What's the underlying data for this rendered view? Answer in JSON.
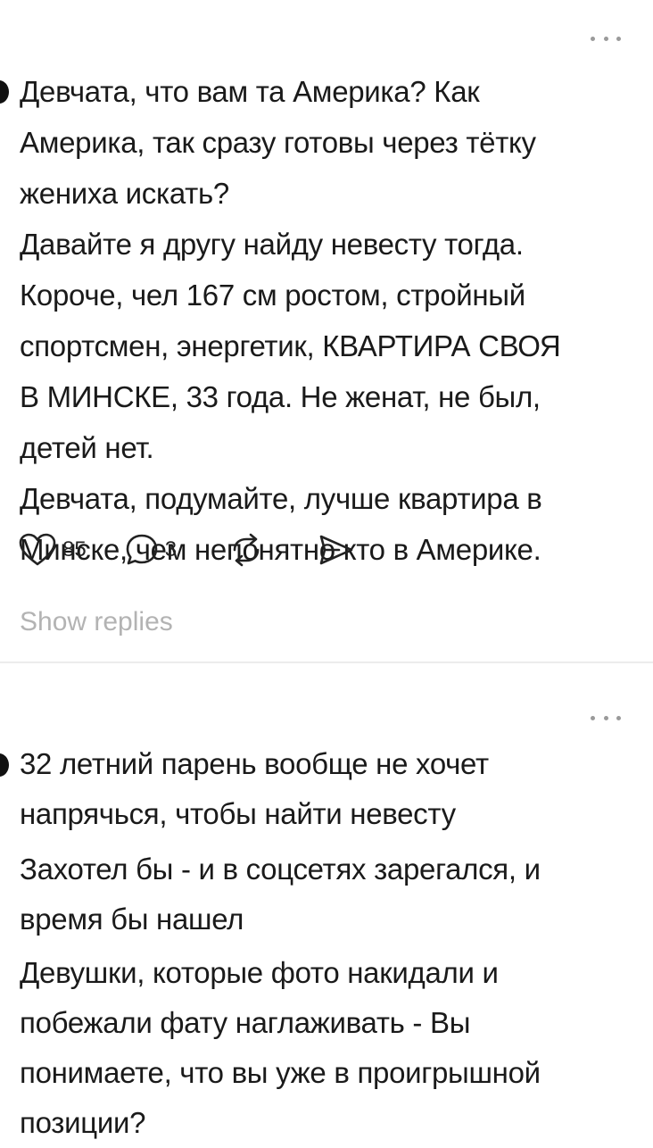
{
  "post1": {
    "lines": [
      "Девчата, что вам та Америка? Как",
      "Америка, так сразу готовы через тётку",
      "жениха искать?",
      "Давайте я другу найду невесту тогда.",
      "Короче, чел 167 см ростом, стройный",
      "спортсмен, энергетик, КВАРТИРА СВОЯ",
      "В МИНСКЕ, 33 года. Не женат, не был,",
      "детей нет.",
      "Девчата, подумайте, лучше квартира в",
      "Минске, чем непонятно кто в Америке."
    ],
    "likes": "85",
    "comments": "3",
    "show_replies": "Show replies",
    "icons": {
      "like": "heart-icon",
      "comment": "comment-bubble-icon",
      "repost": "repost-icon",
      "share": "share-icon",
      "more": "more-dots-icon"
    }
  },
  "post2": {
    "block1": [
      "32 летний парень вообще не хочет",
      "напрячься, чтобы найти невесту"
    ],
    "block2": [
      "Захотел бы - и в соцсетях зарегался, и",
      "время бы нашел"
    ],
    "block3": [
      "Девушки, которые фото накидали и",
      "побежали фату наглаживать - Вы",
      "понимаете, что вы уже в проигрышной",
      "позиции?"
    ]
  },
  "colors": {
    "text": "#1a1a1a",
    "muted": "#b3b3b3",
    "dots": "#9a9a9a",
    "divider": "#ececec"
  }
}
